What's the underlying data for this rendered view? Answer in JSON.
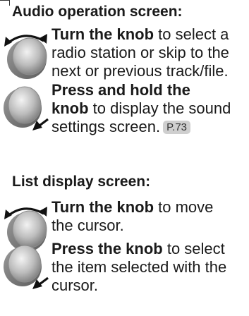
{
  "audio_section": {
    "title": "Audio operation screen:",
    "turn": {
      "bold": "Turn the knob",
      "lines": [
        " to select a",
        "radio station or skip to the",
        "next or previous track/file."
      ]
    },
    "press_hold": {
      "bold_line1": "Press and hold the",
      "bold_line2": "knob",
      "line2_rest": " to display the sound",
      "line3": "settings screen.",
      "page_ref": "P.73"
    }
  },
  "list_section": {
    "title": "List display screen:",
    "turn": {
      "bold": "Turn the knob",
      "rest": " to move",
      "line2": "the cursor."
    },
    "press": {
      "bold": "Press the knob",
      "rest": " to select",
      "line2": "the item selected with the",
      "line3": "cursor."
    }
  },
  "icons": {
    "turn": "knob-turn-icon",
    "press": "knob-press-icon"
  }
}
